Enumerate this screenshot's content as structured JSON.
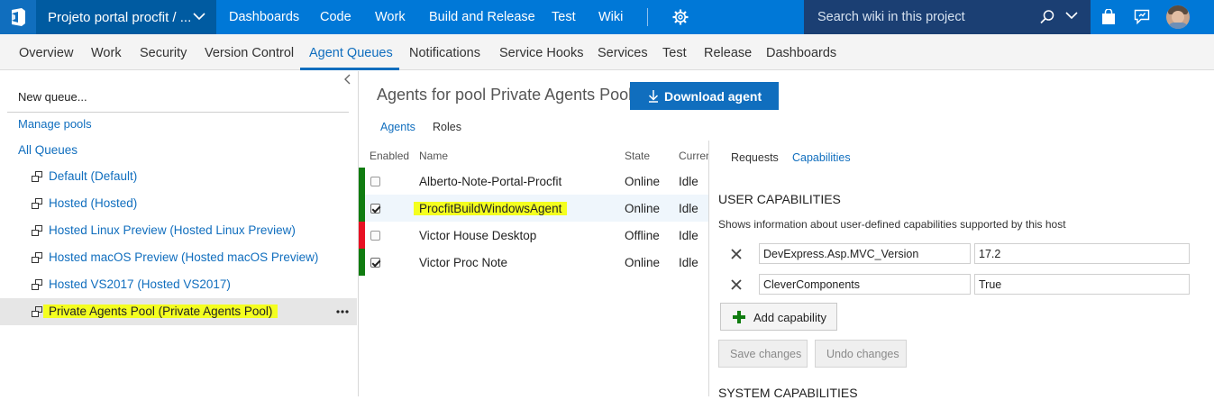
{
  "topbar": {
    "project_name": "Projeto portal procfit / ...",
    "nav": [
      "Dashboards",
      "Code",
      "Work",
      "Build and Release",
      "Test",
      "Wiki"
    ],
    "search_placeholder": "Search wiki in this project",
    "colors": {
      "bar": "#0078d7",
      "project": "#005ba1",
      "search": "#1b3f73"
    }
  },
  "admin_tabs": {
    "items": [
      "Overview",
      "Work",
      "Security",
      "Version Control",
      "Agent Queues",
      "Notifications",
      "Service Hooks",
      "Services",
      "Test",
      "Release",
      "Dashboards"
    ],
    "active": "Agent Queues"
  },
  "left": {
    "new_queue": "New queue...",
    "manage_pools": "Manage pools",
    "all_queues": "All Queues",
    "queues": [
      "Default (Default)",
      "Hosted (Hosted)",
      "Hosted Linux Preview (Hosted Linux Preview)",
      "Hosted macOS Preview (Hosted macOS Preview)",
      "Hosted VS2017 (Hosted VS2017)",
      "Private Agents Pool (Private Agents Pool)"
    ],
    "selected_queue": "Private Agents Pool (Private Agents Pool)",
    "icons": {
      "collapse": "chevron-left-icon",
      "queue": "queue-icon",
      "more": "more-dots-icon"
    }
  },
  "center": {
    "title": "Agents for pool Private Agents Pool",
    "download_label": "Download agent",
    "tabs": [
      "Agents",
      "Roles"
    ],
    "active_tab": "Agents",
    "columns": [
      "Enabled",
      "Name",
      "State",
      "Curren"
    ],
    "agents": [
      {
        "name": "Alberto-Note-Portal-Procfit",
        "enabled": false,
        "state": "Online",
        "current": "Idle",
        "status_color": "#107c10"
      },
      {
        "name": "ProcfitBuildWindowsAgent",
        "enabled": true,
        "state": "Online",
        "current": "Idle",
        "status_color": "#107c10"
      },
      {
        "name": "Victor House Desktop",
        "enabled": false,
        "state": "Offline",
        "current": "Idle",
        "status_color": "#e81123"
      },
      {
        "name": "Victor Proc Note",
        "enabled": true,
        "state": "Online",
        "current": "Idle",
        "status_color": "#107c10"
      }
    ]
  },
  "right": {
    "tabs": [
      "Requests",
      "Capabilities"
    ],
    "active_tab": "Capabilities",
    "user_caps_title": "USER CAPABILITIES",
    "user_caps_desc": "Shows information about user-defined capabilities supported by this host",
    "capabilities": [
      {
        "key": "DevExpress.Asp.MVC_Version",
        "value": "17.2"
      },
      {
        "key": "CleverComponents",
        "value": "True"
      }
    ],
    "add_capability": "Add capability",
    "save_changes": "Save changes",
    "undo_changes": "Undo changes",
    "system_caps_title": "SYSTEM CAPABILITIES"
  },
  "colors": {
    "accent": "#106ebe",
    "highlight": "#f4ff1f",
    "online": "#107c10",
    "offline": "#e81123"
  }
}
